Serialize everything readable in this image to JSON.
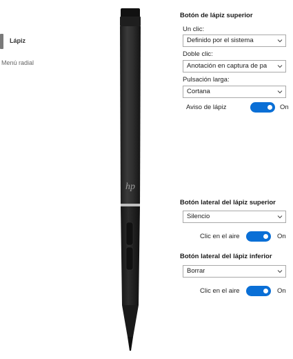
{
  "nav": {
    "items": [
      {
        "label": "Lápiz",
        "active": true
      },
      {
        "label": "Menú radial",
        "active": false
      }
    ]
  },
  "pen": {
    "brand_mark": "hp"
  },
  "top_button": {
    "title": "Botón de lápiz superior",
    "single_click_label": "Un clic:",
    "single_click_value": "Definido por el sistema",
    "double_click_label": "Doble clic:",
    "double_click_value": "Anotación en captura de pa",
    "long_press_label": "Pulsación larga:",
    "long_press_value": "Cortana",
    "pen_notice_label": "Aviso de lápiz",
    "pen_notice_state": "On",
    "pen_notice_on": true
  },
  "upper_side_button": {
    "title": "Botón lateral del lápiz superior",
    "action_value": "Silencio",
    "air_click_label": "Clic en el aire",
    "air_click_state": "On",
    "air_click_on": true
  },
  "lower_side_button": {
    "title": "Botón lateral del lápiz inferior",
    "action_value": "Borrar",
    "air_click_label": "Clic en el aire",
    "air_click_state": "On",
    "air_click_on": true
  },
  "colors": {
    "toggle_on": "#0a6fd6",
    "nav_indicator": "#7a7a7a",
    "pen_body": "#2b2b2b"
  }
}
